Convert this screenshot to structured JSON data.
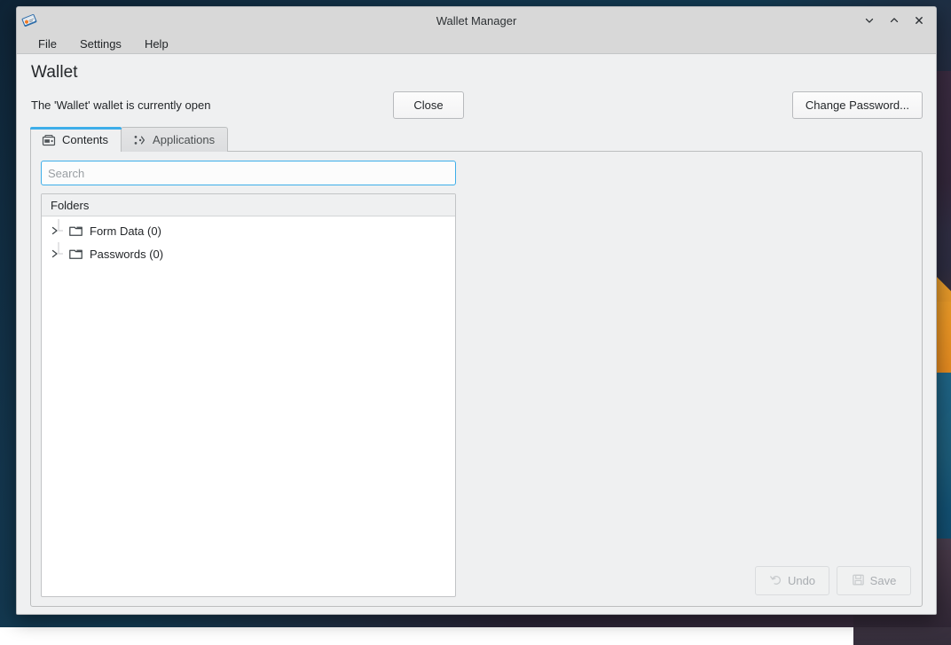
{
  "window": {
    "title": "Wallet Manager",
    "app_icon": "wallet-app-icon",
    "controls": [
      {
        "name": "minimize-button",
        "icon": "chevron-down-icon"
      },
      {
        "name": "maximize-button",
        "icon": "chevron-up-icon"
      },
      {
        "name": "close-window-button",
        "icon": "close-x-icon"
      }
    ]
  },
  "menubar": {
    "items": [
      {
        "label": "File",
        "name": "menu-file"
      },
      {
        "label": "Settings",
        "name": "menu-settings"
      },
      {
        "label": "Help",
        "name": "menu-help"
      }
    ]
  },
  "page": {
    "title": "Wallet",
    "status_text": "The 'Wallet' wallet is currently open",
    "close_label": "Close",
    "change_password_label": "Change Password..."
  },
  "tabs": [
    {
      "label": "Contents",
      "icon": "wallet-contents-icon",
      "active": true
    },
    {
      "label": "Applications",
      "icon": "applications-plug-icon",
      "active": false
    }
  ],
  "search": {
    "value": "",
    "placeholder": "Search"
  },
  "tree": {
    "header": "Folders",
    "rows": [
      {
        "label": "Form Data (0)",
        "icon": "folder-icon",
        "expander": "chevron-right-icon"
      },
      {
        "label": "Passwords (0)",
        "icon": "folder-icon",
        "expander": "chevron-right-icon"
      }
    ]
  },
  "actions": {
    "undo_label": "Undo",
    "save_label": "Save",
    "undo_icon": "undo-arrow-icon",
    "save_icon": "floppy-save-icon",
    "undo_enabled": false,
    "save_enabled": false
  },
  "colors": {
    "accent": "#3daee9",
    "window_bg": "#eff0f1",
    "titlebar_bg": "#d8d8d8",
    "text": "#232629",
    "disabled_text": "#a9adb1",
    "tree_bg": "#ffffff"
  }
}
